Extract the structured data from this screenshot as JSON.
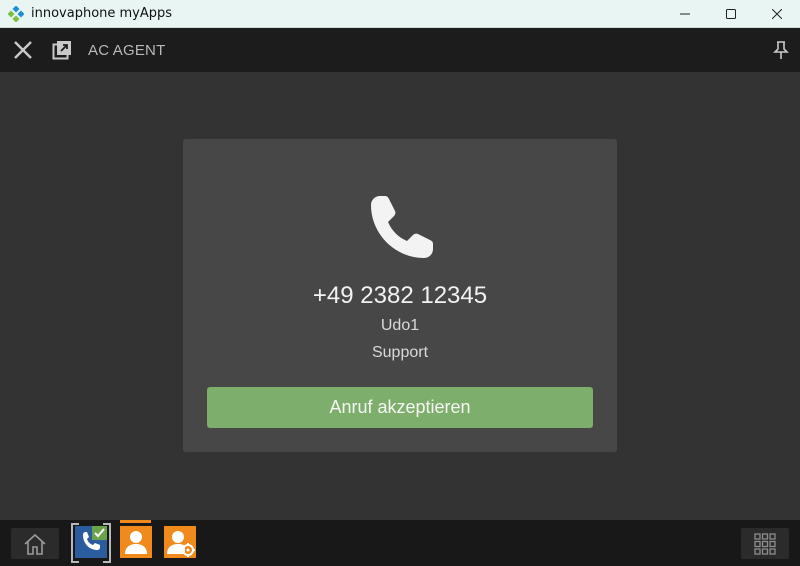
{
  "window": {
    "title": "innovaphone myApps"
  },
  "header": {
    "title": "AC AGENT"
  },
  "call": {
    "number": "+49 2382 12345",
    "name": "Udo1",
    "group": "Support",
    "accept_label": "Anruf akzeptieren"
  },
  "colors": {
    "accept": "#7eae6c",
    "accent": "#f08a1c",
    "phone_app": "#2b5c9e"
  },
  "taskbar": {
    "apps": [
      {
        "icon": "phone-app-icon",
        "status": "checkmark-icon"
      },
      {
        "icon": "agent-app-icon"
      },
      {
        "icon": "agent-admin-app-icon"
      }
    ]
  }
}
